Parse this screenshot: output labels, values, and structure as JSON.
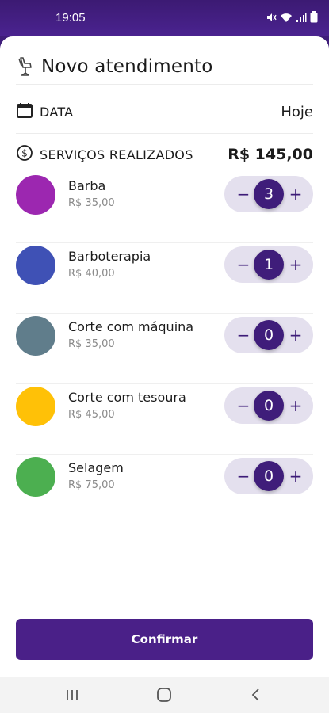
{
  "status_bar": {
    "time": "19:05",
    "icons": [
      "mute-icon",
      "wifi-icon",
      "signal-icon",
      "battery-icon"
    ]
  },
  "header": {
    "title": "Novo atendimento",
    "icon": "barber-chair-icon"
  },
  "date_row": {
    "icon": "calendar-icon",
    "label": "DATA",
    "value": "Hoje"
  },
  "services_row": {
    "icon": "dollar-circle-icon",
    "label": "SERVIÇOS REALIZADOS",
    "total": "R$ 145,00"
  },
  "services": [
    {
      "name": "Barba",
      "price": "R$ 35,00",
      "color": "#9c27b0",
      "quantity": "3"
    },
    {
      "name": "Barboterapia",
      "price": "R$ 40,00",
      "color": "#3f51b5",
      "quantity": "1"
    },
    {
      "name": "Corte com máquina",
      "price": "R$ 35,00",
      "color": "#607d8b",
      "quantity": "0"
    },
    {
      "name": "Corte com tesoura",
      "price": "R$ 45,00",
      "color": "#ffc107",
      "quantity": "0"
    },
    {
      "name": "Selagem",
      "price": "R$ 75,00",
      "color": "#4caf50",
      "quantity": "0"
    }
  ],
  "stepper": {
    "minus": "−",
    "plus": "+"
  },
  "confirm_label": "Confirmar",
  "colors": {
    "primary": "#4a2088",
    "stepper_bg": "#e4e0ee"
  },
  "nav": [
    "recent-apps-icon",
    "home-icon",
    "back-icon"
  ]
}
